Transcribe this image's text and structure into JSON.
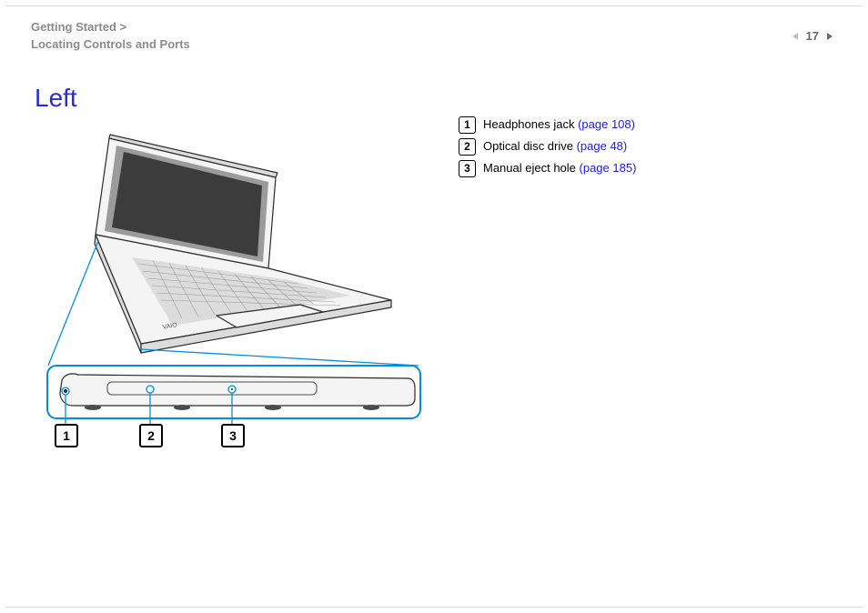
{
  "breadcrumb": {
    "line1": "Getting Started >",
    "line2": "Locating Controls and Ports"
  },
  "page_number": "17",
  "heading": "Left",
  "legend": {
    "items": [
      {
        "num": "1",
        "label": "Headphones jack ",
        "link": "(page 108)"
      },
      {
        "num": "2",
        "label": "Optical disc drive ",
        "link": "(page 48)"
      },
      {
        "num": "3",
        "label": "Manual eject hole ",
        "link": "(page 185)"
      }
    ]
  },
  "illustration": {
    "callouts": {
      "n1": "1",
      "n2": "2",
      "n3": "3"
    }
  }
}
